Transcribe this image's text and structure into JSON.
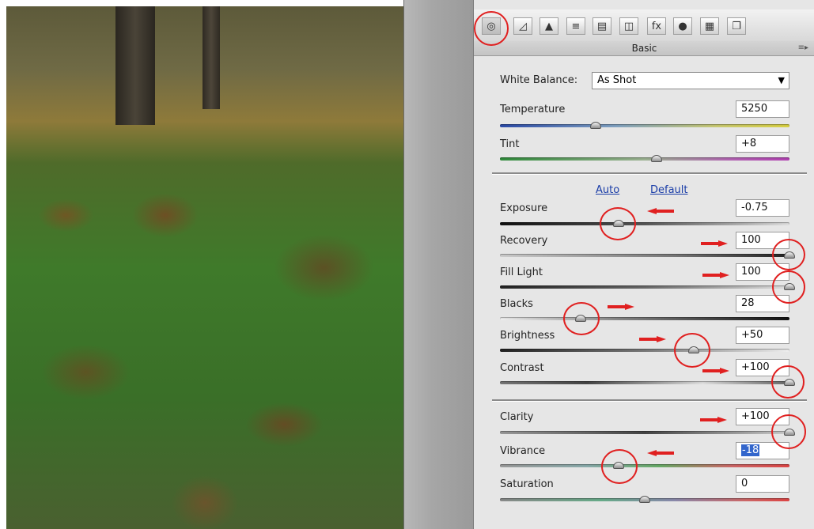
{
  "panel": {
    "title": "Basic",
    "menu_icon": "panel-menu-icon"
  },
  "toolbar": {
    "tabs": [
      {
        "name": "basic-tab-icon",
        "glyph": "◎"
      },
      {
        "name": "tone-curve-tab-icon",
        "glyph": "◿"
      },
      {
        "name": "detail-tab-icon",
        "glyph": "▲"
      },
      {
        "name": "hsl-tab-icon",
        "glyph": "≡"
      },
      {
        "name": "split-toning-tab-icon",
        "glyph": "▤"
      },
      {
        "name": "lens-corrections-tab-icon",
        "glyph": "◫"
      },
      {
        "name": "effects-tab-icon",
        "glyph": "fx"
      },
      {
        "name": "camera-calibration-tab-icon",
        "glyph": "●"
      },
      {
        "name": "presets-tab-icon",
        "glyph": "▦"
      },
      {
        "name": "snapshots-tab-icon",
        "glyph": "❐"
      }
    ]
  },
  "white_balance": {
    "label": "White Balance:",
    "value": "As Shot",
    "caret": "▼"
  },
  "links": {
    "auto": "Auto",
    "default": "Default"
  },
  "sliders": [
    {
      "id": "temperature",
      "label": "Temperature",
      "value": "5250",
      "position": 0.33
    },
    {
      "id": "tint",
      "label": "Tint",
      "value": "+8",
      "position": 0.54
    },
    {
      "id": "exposure",
      "label": "Exposure",
      "value": "-0.75",
      "position": 0.41
    },
    {
      "id": "recovery",
      "label": "Recovery",
      "value": "100",
      "position": 1.0
    },
    {
      "id": "fill-light",
      "label": "Fill Light",
      "value": "100",
      "position": 1.0
    },
    {
      "id": "blacks",
      "label": "Blacks",
      "value": "28",
      "position": 0.28
    },
    {
      "id": "brightness",
      "label": "Brightness",
      "value": "+50",
      "position": 0.67
    },
    {
      "id": "contrast",
      "label": "Contrast",
      "value": "+100",
      "position": 1.0
    },
    {
      "id": "clarity",
      "label": "Clarity",
      "value": "+100",
      "position": 1.0
    },
    {
      "id": "vibrance",
      "label": "Vibrance",
      "value": "-18",
      "position": 0.41
    },
    {
      "id": "saturation",
      "label": "Saturation",
      "value": "0",
      "position": 0.5
    }
  ],
  "colors": {
    "annotation": "#e02020",
    "link": "#1a3da8"
  }
}
